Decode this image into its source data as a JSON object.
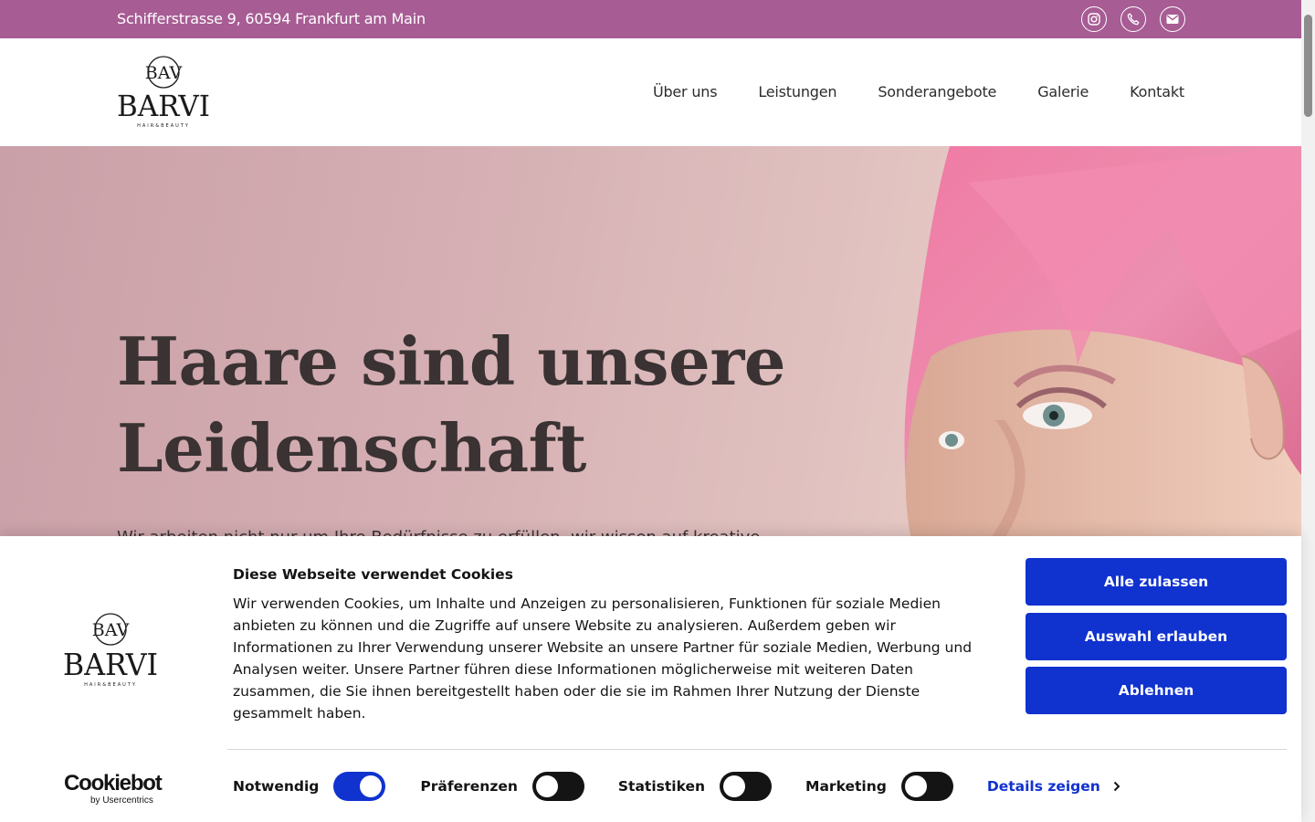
{
  "topbar": {
    "address": "Schifferstrasse 9, 60594 Frankfurt am Main",
    "icons": [
      "instagram-icon",
      "phone-icon",
      "mail-icon"
    ],
    "color": "#a75c94"
  },
  "brand": {
    "monogram": "BAV",
    "name": "BARVI",
    "tagline": "HAIR&BEAUTY"
  },
  "nav": {
    "items": [
      "Über uns",
      "Leistungen",
      "Sonderangebote",
      "Galerie",
      "Kontakt"
    ]
  },
  "hero": {
    "headline_line1": "Haare sind unsere",
    "headline_line2": "Leidenschaft",
    "lead": "Wir arbeiten nicht nur um Ihre Bedürfnisse zu erfüllen, wir wissen auf kreative"
  },
  "cookie": {
    "title": "Diese Webseite verwendet Cookies",
    "text": "Wir verwenden Cookies, um Inhalte und Anzeigen zu personalisieren, Funktionen für soziale Medien anbieten zu können und die Zugriffe auf unsere Website zu analysieren. Außerdem geben wir Informationen zu Ihrer Verwendung unserer Website an unsere Partner für soziale Medien, Werbung und Analysen weiter. Unsere Partner führen diese Informationen möglicherweise mit weiteren Daten zusammen, die Sie ihnen bereitgestellt haben oder die sie im Rahmen Ihrer Nutzung der Dienste gesammelt haben.",
    "buttons": {
      "allow_all": "Alle zulassen",
      "allow_selection": "Auswahl erlauben",
      "deny": "Ablehnen"
    },
    "toggles": [
      {
        "label": "Notwendig",
        "on": true
      },
      {
        "label": "Präferenzen",
        "on": false
      },
      {
        "label": "Statistiken",
        "on": false
      },
      {
        "label": "Marketing",
        "on": false
      }
    ],
    "details_link": "Details zeigen",
    "provider": "Cookiebot",
    "provider_sub": "by Usercentrics",
    "accent": "#1032cf"
  }
}
